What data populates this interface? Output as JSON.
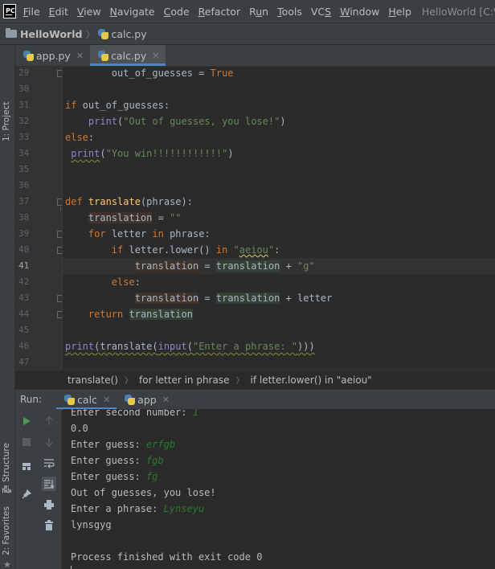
{
  "menu": {
    "logo": "PC",
    "items": [
      {
        "label": "File",
        "mnemonic": "F"
      },
      {
        "label": "Edit",
        "mnemonic": "E"
      },
      {
        "label": "View",
        "mnemonic": "V"
      },
      {
        "label": "Navigate",
        "mnemonic": "N"
      },
      {
        "label": "Code",
        "mnemonic": "C"
      },
      {
        "label": "Refactor",
        "mnemonic": "R"
      },
      {
        "label": "Run",
        "mnemonic": "u"
      },
      {
        "label": "Tools",
        "mnemonic": "T"
      },
      {
        "label": "VCS",
        "mnemonic": "S"
      },
      {
        "label": "Window",
        "mnemonic": "W"
      },
      {
        "label": "Help",
        "mnemonic": "H"
      }
    ],
    "window_title": "HelloWorld [C:\\Users\\Ly"
  },
  "navbar": {
    "project": "HelloWorld",
    "file": "calc.py"
  },
  "left_strip": {
    "project_tab": "1: Project",
    "structure_tab": "Z: Structure",
    "favorites_tab": "2: Favorites"
  },
  "editor_tabs": [
    {
      "label": "app.py",
      "active": false
    },
    {
      "label": "calc.py",
      "active": true
    }
  ],
  "editor": {
    "line_numbers": [
      "29",
      "30",
      "31",
      "32",
      "33",
      "34",
      "35",
      "36",
      "37",
      "38",
      "39",
      "40",
      "41",
      "42",
      "43",
      "44",
      "45",
      "46",
      "47"
    ],
    "current_line": "41"
  },
  "breadcrumb": [
    "translate()",
    "for letter in phrase",
    "if letter.lower() in \"aeiou\""
  ],
  "run_panel": {
    "label": "Run:",
    "tabs": [
      {
        "label": "calc",
        "active": true
      },
      {
        "label": "app",
        "active": false
      }
    ],
    "console": [
      {
        "prompt": "Enter second number: ",
        "input": "1"
      },
      {
        "prompt": "0.0",
        "input": ""
      },
      {
        "prompt": "Enter guess: ",
        "input": "erfgb"
      },
      {
        "prompt": "Enter guess: ",
        "input": "fgb"
      },
      {
        "prompt": "Enter guess: ",
        "input": "fg"
      },
      {
        "prompt": "Out of guesses, you lose!",
        "input": ""
      },
      {
        "prompt": "Enter a phrase: ",
        "input": "Lynseyu"
      },
      {
        "prompt": "lynsgyg",
        "input": ""
      },
      {
        "prompt": "",
        "input": ""
      },
      {
        "prompt": "Process finished with exit code 0",
        "input": ""
      }
    ]
  },
  "colors": {
    "keyword": "#cc7832",
    "string": "#6a8759",
    "function": "#ffc66d",
    "builtin": "#8888c6",
    "accent": "#4a88c7",
    "console_input": "#287b2b"
  }
}
